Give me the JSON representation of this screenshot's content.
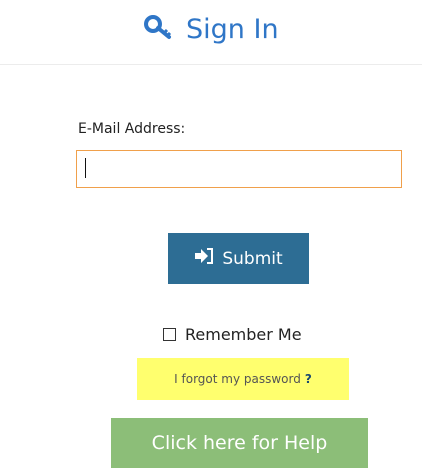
{
  "header": {
    "title": "Sign In",
    "icon": "key-icon"
  },
  "form": {
    "email_label": "E-Mail Address:",
    "email_value": "",
    "email_placeholder": "",
    "submit_label": "Submit",
    "submit_icon": "sign-in-icon",
    "remember_label": "Remember Me",
    "remember_checked": false,
    "forgot_label": "I forgot my password",
    "forgot_suffix": "?",
    "help_label": "Click here for Help"
  },
  "colors": {
    "accent_blue": "#2f76c7",
    "submit_bg": "#2d6d94",
    "input_border": "#f0a04b",
    "forgot_bg": "#ffff6e",
    "help_bg": "#8cbe78"
  }
}
